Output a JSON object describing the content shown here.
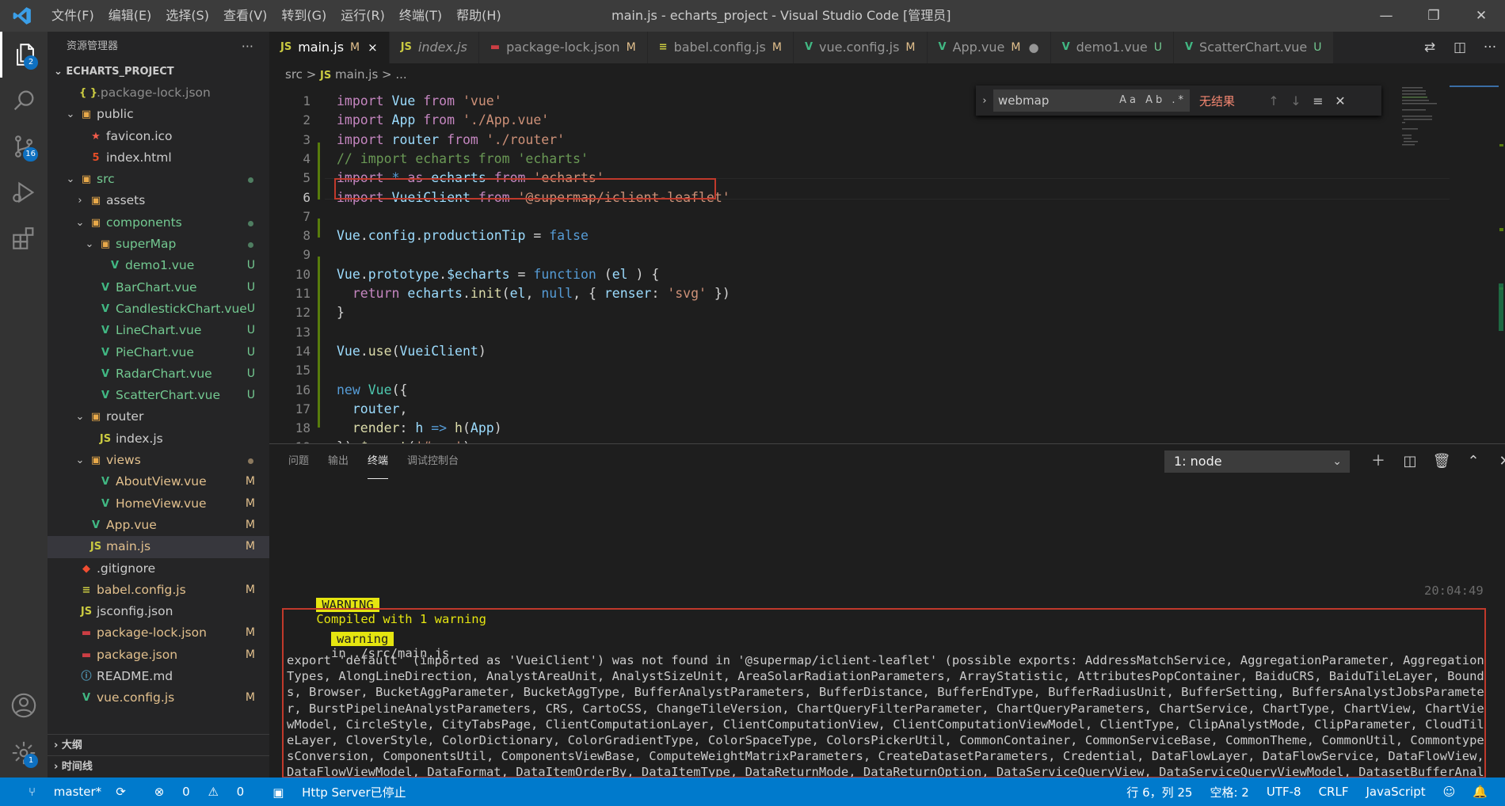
{
  "titlebar": {
    "menu": [
      "文件(F)",
      "编辑(E)",
      "选择(S)",
      "查看(V)",
      "转到(G)",
      "运行(R)",
      "终端(T)",
      "帮助(H)"
    ],
    "title": "main.js - echarts_project - Visual Studio Code [管理员]"
  },
  "activity": {
    "explorer_badge": "2",
    "scm_badge": "16",
    "settings_badge": "1"
  },
  "sidebar": {
    "header": "资源管理器",
    "project": "ECHARTS_PROJECT",
    "items": [
      {
        "name": ".package-lock.json",
        "icon": "{ }",
        "status": "",
        "cls": "c-gray",
        "indent": 1,
        "chev": ""
      },
      {
        "name": "public",
        "icon": "▣",
        "status": "",
        "cls": "c-def",
        "indent": 1,
        "chev": "v"
      },
      {
        "name": "favicon.ico",
        "icon": "★",
        "status": "",
        "cls": "c-def",
        "indent": 2,
        "chev": ""
      },
      {
        "name": "index.html",
        "icon": "5",
        "status": "",
        "cls": "c-def",
        "indent": 2,
        "chev": ""
      },
      {
        "name": "src",
        "icon": "▣",
        "status": "dot",
        "cls": "c-unt",
        "indent": 1,
        "chev": "v"
      },
      {
        "name": "assets",
        "icon": "▣",
        "status": "",
        "cls": "c-def",
        "indent": 2,
        "chev": ">"
      },
      {
        "name": "components",
        "icon": "▣",
        "status": "dot",
        "cls": "c-unt",
        "indent": 2,
        "chev": "v"
      },
      {
        "name": "superMap",
        "icon": "▣",
        "status": "dot",
        "cls": "c-unt",
        "indent": 3,
        "chev": "v"
      },
      {
        "name": "demo1.vue",
        "icon": "V",
        "status": "U",
        "cls": "c-unt",
        "indent": 4,
        "chev": ""
      },
      {
        "name": "BarChart.vue",
        "icon": "V",
        "status": "U",
        "cls": "c-unt",
        "indent": 3,
        "chev": ""
      },
      {
        "name": "CandlestickChart.vue",
        "icon": "V",
        "status": "U",
        "cls": "c-unt",
        "indent": 3,
        "chev": ""
      },
      {
        "name": "LineChart.vue",
        "icon": "V",
        "status": "U",
        "cls": "c-unt",
        "indent": 3,
        "chev": ""
      },
      {
        "name": "PieChart.vue",
        "icon": "V",
        "status": "U",
        "cls": "c-unt",
        "indent": 3,
        "chev": ""
      },
      {
        "name": "RadarChart.vue",
        "icon": "V",
        "status": "U",
        "cls": "c-unt",
        "indent": 3,
        "chev": ""
      },
      {
        "name": "ScatterChart.vue",
        "icon": "V",
        "status": "U",
        "cls": "c-unt",
        "indent": 3,
        "chev": ""
      },
      {
        "name": "router",
        "icon": "▣",
        "status": "",
        "cls": "c-def",
        "indent": 2,
        "chev": "v"
      },
      {
        "name": "index.js",
        "icon": "JS",
        "status": "",
        "cls": "c-def",
        "indent": 3,
        "chev": ""
      },
      {
        "name": "views",
        "icon": "▣",
        "status": "dotm",
        "cls": "c-mod",
        "indent": 2,
        "chev": "v"
      },
      {
        "name": "AboutView.vue",
        "icon": "V",
        "status": "M",
        "cls": "c-mod",
        "indent": 3,
        "chev": ""
      },
      {
        "name": "HomeView.vue",
        "icon": "V",
        "status": "M",
        "cls": "c-mod",
        "indent": 3,
        "chev": ""
      },
      {
        "name": "App.vue",
        "icon": "V",
        "status": "M",
        "cls": "c-mod",
        "indent": 2,
        "chev": ""
      },
      {
        "name": "main.js",
        "icon": "JS",
        "status": "M",
        "cls": "c-mod",
        "indent": 2,
        "chev": "",
        "selected": true
      },
      {
        "name": ".gitignore",
        "icon": "◆",
        "status": "",
        "cls": "c-def",
        "indent": 1,
        "chev": ""
      },
      {
        "name": "babel.config.js",
        "icon": "≡",
        "status": "M",
        "cls": "c-mod",
        "indent": 1,
        "chev": ""
      },
      {
        "name": "jsconfig.json",
        "icon": "JS",
        "status": "",
        "cls": "c-def",
        "indent": 1,
        "chev": ""
      },
      {
        "name": "package-lock.json",
        "icon": "▬",
        "status": "M",
        "cls": "c-mod",
        "indent": 1,
        "chev": ""
      },
      {
        "name": "package.json",
        "icon": "▬",
        "status": "M",
        "cls": "c-mod",
        "indent": 1,
        "chev": ""
      },
      {
        "name": "README.md",
        "icon": "ⓘ",
        "status": "",
        "cls": "c-def",
        "indent": 1,
        "chev": ""
      },
      {
        "name": "vue.config.js",
        "icon": "V",
        "status": "M",
        "cls": "c-mod",
        "indent": 1,
        "chev": ""
      }
    ],
    "outline": "大纲",
    "timeline": "时间线"
  },
  "tabs": [
    {
      "icon": "JS",
      "label": "main.js",
      "mark": "M",
      "close": "×",
      "active": true,
      "iconColor": "#cbcb41",
      "italic": false,
      "markColor": "#e2c08d"
    },
    {
      "icon": "JS",
      "label": "index.js",
      "mark": "",
      "close": "",
      "active": false,
      "iconColor": "#cbcb41",
      "italic": true,
      "markColor": ""
    },
    {
      "icon": "▬",
      "label": "package-lock.json",
      "mark": "M",
      "close": "",
      "active": false,
      "iconColor": "#cc3e44",
      "italic": false,
      "markColor": "#e2c08d"
    },
    {
      "icon": "≡",
      "label": "babel.config.js",
      "mark": "M",
      "close": "",
      "active": false,
      "iconColor": "#cbcb41",
      "italic": false,
      "markColor": "#e2c08d"
    },
    {
      "icon": "V",
      "label": "vue.config.js",
      "mark": "M",
      "close": "",
      "active": false,
      "iconColor": "#41b883",
      "italic": false,
      "markColor": "#e2c08d"
    },
    {
      "icon": "V",
      "label": "App.vue",
      "mark": "M",
      "close": "●",
      "active": false,
      "iconColor": "#41b883",
      "italic": false,
      "markColor": "#e2c08d"
    },
    {
      "icon": "V",
      "label": "demo1.vue",
      "mark": "U",
      "close": "",
      "active": false,
      "iconColor": "#41b883",
      "italic": false,
      "markColor": "#73c991"
    },
    {
      "icon": "V",
      "label": "ScatterChart.vue",
      "mark": "U",
      "close": "",
      "active": false,
      "iconColor": "#41b883",
      "italic": false,
      "markColor": "#73c991"
    }
  ],
  "breadcrumb": {
    "folder": "src",
    "sep": ">",
    "js": "JS",
    "file": "main.js",
    "tail": "> ..."
  },
  "editor": {
    "current_line": 6,
    "lines": [
      [
        [
          "kw",
          "import "
        ],
        [
          "var",
          "Vue"
        ],
        [
          "kw",
          " from "
        ],
        [
          "str",
          "'vue'"
        ]
      ],
      [
        [
          "kw",
          "import "
        ],
        [
          "var",
          "App"
        ],
        [
          "kw",
          " from "
        ],
        [
          "str",
          "'./App.vue'"
        ]
      ],
      [
        [
          "kw",
          "import "
        ],
        [
          "var",
          "router"
        ],
        [
          "kw",
          " from "
        ],
        [
          "str",
          "'./router'"
        ]
      ],
      [
        [
          "cmt",
          "// import echarts from 'echarts'"
        ]
      ],
      [
        [
          "kw",
          "import "
        ],
        [
          "kw2",
          "* "
        ],
        [
          "kw",
          "as "
        ],
        [
          "var",
          "echarts"
        ],
        [
          "kw",
          " from "
        ],
        [
          "str",
          "'echarts'"
        ]
      ],
      [
        [
          "kw",
          "import "
        ],
        [
          "var",
          "VueiClient"
        ],
        [
          "kw",
          " from "
        ],
        [
          "str",
          "'@supermap/iclient-leaflet'"
        ]
      ],
      [],
      [
        [
          "var",
          "Vue"
        ],
        [
          "",
          "."
        ],
        [
          "var",
          "config"
        ],
        [
          "",
          "."
        ],
        [
          "var",
          "productionTip"
        ],
        [
          "",
          " = "
        ],
        [
          "kw2",
          "false"
        ]
      ],
      [],
      [
        [
          "var",
          "Vue"
        ],
        [
          "",
          "."
        ],
        [
          "var",
          "prototype"
        ],
        [
          "",
          "."
        ],
        [
          "var",
          "$echarts"
        ],
        [
          "",
          " = "
        ],
        [
          "kw2",
          "function "
        ],
        [
          "",
          "("
        ],
        [
          "var",
          "el"
        ],
        [
          "",
          " ) {"
        ]
      ],
      [
        [
          "",
          ""
        ],
        [
          "kw",
          "  return "
        ],
        [
          "var",
          "echarts"
        ],
        [
          "",
          "."
        ],
        [
          "fn",
          "init"
        ],
        [
          "",
          "("
        ],
        [
          "var",
          "el"
        ],
        [
          "",
          ", "
        ],
        [
          "kw2",
          "null"
        ],
        [
          "",
          ", { "
        ],
        [
          "var",
          "renser"
        ],
        [
          "",
          ": "
        ],
        [
          "str",
          "'svg'"
        ],
        [
          "",
          " })"
        ]
      ],
      [
        [
          "",
          "}"
        ]
      ],
      [],
      [
        [
          "var",
          "Vue"
        ],
        [
          "",
          "."
        ],
        [
          "fn",
          "use"
        ],
        [
          "",
          "("
        ],
        [
          "var",
          "VueiClient"
        ],
        [
          "",
          ")"
        ]
      ],
      [],
      [
        [
          "kw2",
          "new "
        ],
        [
          "cls",
          "Vue"
        ],
        [
          "",
          "({"
        ]
      ],
      [
        [
          "var",
          "  router"
        ],
        [
          "",
          ","
        ]
      ],
      [
        [
          "fn",
          "  render"
        ],
        [
          "",
          ": "
        ],
        [
          "var",
          "h"
        ],
        [
          "kw2",
          " => "
        ],
        [
          "fn",
          "h"
        ],
        [
          "",
          "("
        ],
        [
          "var",
          "App"
        ],
        [
          "",
          ")"
        ]
      ],
      [
        [
          "",
          "})."
        ],
        [
          "fn",
          "$mount"
        ],
        [
          "",
          "("
        ],
        [
          "str",
          "'#app'"
        ],
        [
          "",
          ")"
        ]
      ]
    ]
  },
  "find": {
    "value": "webmap",
    "options": "Aa Ab .*",
    "result": "无结果"
  },
  "panel": {
    "tabs": [
      "问题",
      "输出",
      "终端",
      "调试控制台"
    ],
    "active_tab": 2,
    "terminal_select": "1: node",
    "warning_badge": "WARNING",
    "warning_msg": "Compiled with 1 warning",
    "time": "20:04:49",
    "warn_small": "warning",
    "warn_path": "in ./src/main.js",
    "export_text": "export 'default' (imported as 'VueiClient') was not found in '@supermap/iclient-leaflet' (possible exports: AddressMatchService, AggregationParameter, AggregationTypes, AlongLineDirection, AnalystAreaUnit, AnalystSizeUnit, AreaSolarRadiationParameters, ArrayStatistic, AttributesPopContainer, BaiduCRS, BaiduTileLayer, Bounds, Browser, BucketAggParameter, BucketAggType, BufferAnalystParameters, BufferDistance, BufferEndType, BufferRadiusUnit, BufferSetting, BuffersAnalystJobsParameter, BurstPipelineAnalystParameters, CRS, CartoCSS, ChangeTileVersion, ChartQueryFilterParameter, ChartQueryParameters, ChartService, ChartType, ChartView, ChartViewModel, CircleStyle, CityTabsPage, ClientComputationLayer, ClientComputationView, ClientComputationViewModel, ClientType, ClipAnalystMode, ClipParameter, CloudTileLayer, CloverStyle, ColorDictionary, ColorGradientType, ColorSpaceType, ColorsPickerUtil, CommonContainer, CommonServiceBase, CommonTheme, CommonUtil, CommontypesConversion, ComponentsUtil, ComponentsViewBase, ComputeWeightMatrixParameters, CreateDatasetParameters, Credential, DataFlowLayer, DataFlowService, DataFlowView, DataFlowViewModel, DataFormat, DataItemOrderBy, DataItemType, DataReturnMode, DataReturnOption, DataServiceQueryView, DataServiceQueryViewModel, DatasetBufferAnalystParameters, DatasetInfo, DatasetOverlayAnalystParame"
  },
  "statusbar": {
    "branch": "master*",
    "errors": "0",
    "warnings": "0",
    "server": "Http Server已停止",
    "position": "行 6，列 25",
    "spaces": "空格: 2",
    "encoding": "UTF-8",
    "eol": "CRLF",
    "language": "JavaScript"
  },
  "colors": {
    "accent": "#007acc",
    "modified": "#e2c08d",
    "untracked": "#73c991",
    "error_box": "#c0392b"
  }
}
